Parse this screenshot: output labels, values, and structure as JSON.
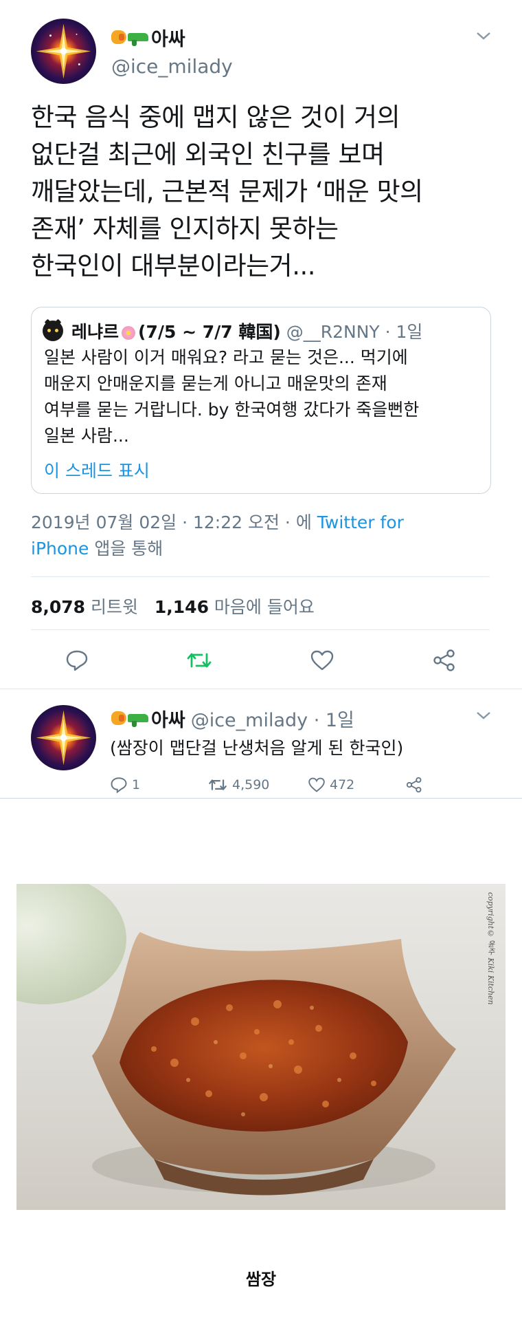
{
  "main_tweet": {
    "display_name": "아싸",
    "handle": "@ice_milady",
    "text_lines": [
      "한국 음식 중에 맵지 않은 것이 거의",
      "없단걸 최근에 외국인 친구를 보며",
      "깨달았는데, 근본적 문제가 ‘매운 맛의",
      "존재’ 자체를 인지하지 못하는",
      "한국인이 대부분이라는거..."
    ],
    "quoted": {
      "name": "레냐르",
      "name_suffix": "(7/5 ~ 7/7 韓国)",
      "handle_time": "@__R2NNY · 1일",
      "text_lines": [
        "일본 사람이 이거 매워요? 라고 묻는 것은... 먹기에",
        "매운지 안매운지를 묻는게 아니고 매운맛의 존재",
        "여부를 묻는 거랍니다. by 한국여행 갔다가 죽을뻔한",
        "일본 사람..."
      ],
      "show_thread": "이 스레드 표시"
    },
    "meta_date": "2019년 07월 02일 · 12:22 오전 · 에",
    "meta_source_1": "Twitter for",
    "meta_source_2": "iPhone",
    "meta_suffix": "앱을 통해",
    "retweet_count": "8,078",
    "retweet_label": "리트윗",
    "like_count": "1,146",
    "like_label": "마음에 들어요"
  },
  "reply_tweet": {
    "display_name": "아싸",
    "handle_time": "@ice_milady · 1일",
    "text": "(쌈장이 맵단걸 난생처음 알게 된 한국인)",
    "reply_count": "1",
    "retweet_count": "4,590",
    "like_count": "472"
  },
  "photo": {
    "watermark": "copyright© 윤주 Kiki Kitchen",
    "caption": "쌈장"
  },
  "colors": {
    "link": "#1b95e0",
    "retweet_green": "#17bf63",
    "secondary_text": "#657786"
  }
}
